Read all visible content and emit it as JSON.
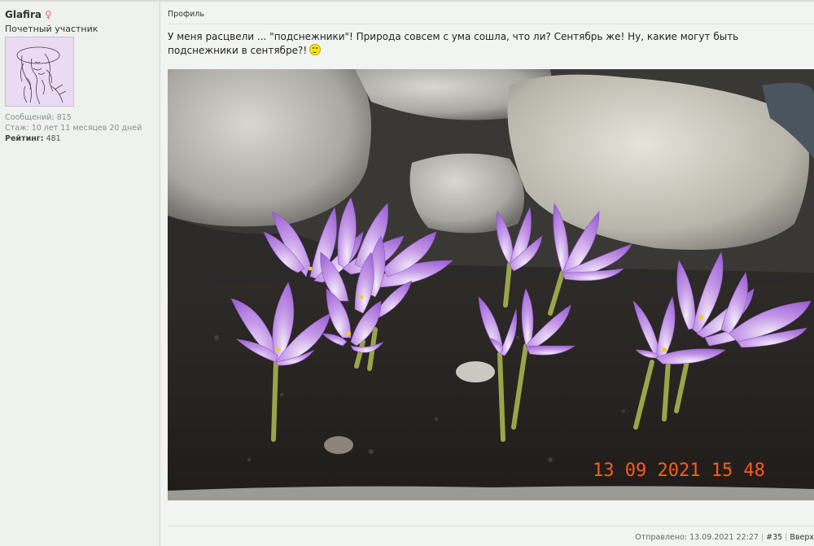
{
  "user": {
    "name": "Glafira",
    "gender_symbol": "♀",
    "rank": "Почетный участник",
    "messages": "Сообщений: 815",
    "tenure": "Стаж: 10 лет 11 месяцев 20 дней",
    "rating_label": "Рейтинг:",
    "rating_value": "481"
  },
  "post": {
    "profile_link": "Профиль",
    "text": "У меня расцвели ... \"подснежники\"! Природа совсем с ума сошла, что ли? Сентябрь же! Ну, какие могут быть подснежники в сентябре?!",
    "photo_timestamp": "13 09 2021 15 48",
    "sent": "Отправлено: 13.09.2021 22:27",
    "number": "#35",
    "top_link": "Вверх"
  },
  "colors": {
    "gender": "#e06a8c",
    "timestamp": "#ff5a1a",
    "petal": "#b27fe0"
  },
  "icons": [
    "gender-female-icon",
    "smiley-icon"
  ]
}
